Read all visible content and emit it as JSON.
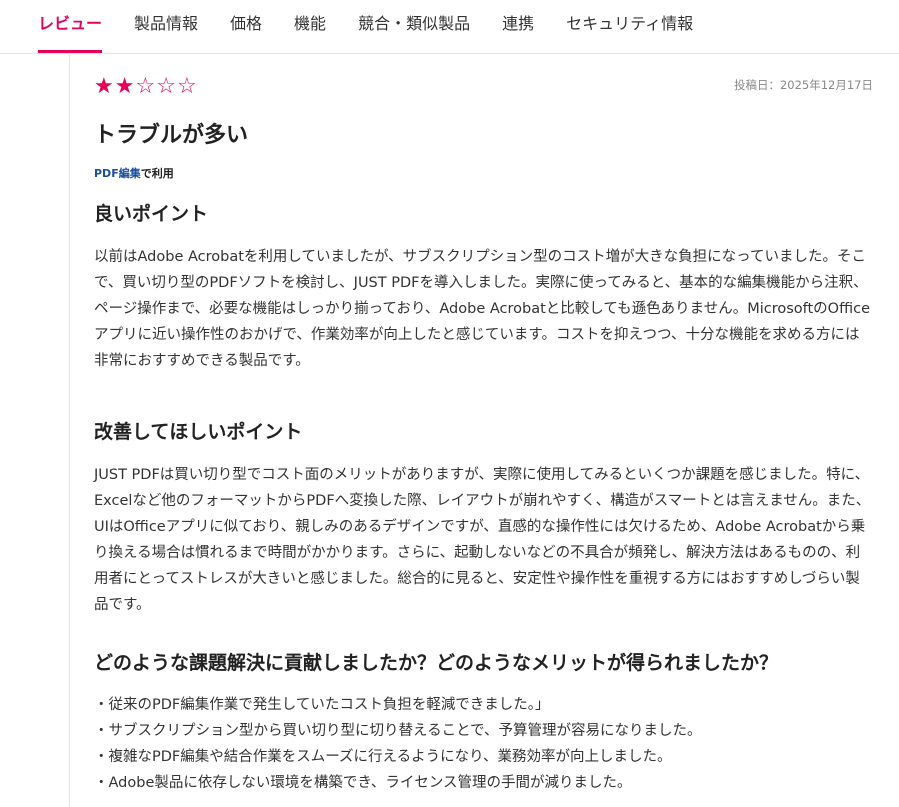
{
  "tabs": [
    {
      "label": "レビュー",
      "active": true
    },
    {
      "label": "製品情報",
      "active": false
    },
    {
      "label": "価格",
      "active": false
    },
    {
      "label": "機能",
      "active": false
    },
    {
      "label": "競合・類似製品",
      "active": false
    },
    {
      "label": "連携",
      "active": false
    },
    {
      "label": "セキュリティ情報",
      "active": false
    }
  ],
  "review": {
    "rating": 2,
    "rating_max": 5,
    "posted_date": "投稿日：2025年12月17日",
    "title": "トラブルが多い",
    "usage_category": "PDF編集",
    "usage_suffix": "で利用",
    "good_heading": "良いポイント",
    "good_text": "以前はAdobe Acrobatを利用していましたが、サブスクリプション型のコスト増が大きな負担になっていました。そこで、買い切り型のPDFソフトを検討し、JUST PDFを導入しました。実際に使ってみると、基本的な編集機能から注釈、ページ操作まで、必要な機能はしっかり揃っており、Adobe Acrobatと比較しても遜色ありません。MicrosoftのOfficeアプリに近い操作性のおかげで、作業効率が向上したと感じています。コストを抑えつつ、十分な機能を求める方には非常におすすめできる製品です。",
    "improve_heading": "改善してほしいポイント",
    "improve_text": "JUST PDFは買い切り型でコスト面のメリットがありますが、実際に使用してみるといくつか課題を感じました。特に、Excelなど他のフォーマットからPDFへ変換した際、レイアウトが崩れやすく、構造がスマートとは言えません。また、UIはOfficeアプリに似ており、親しみのあるデザインですが、直感的な操作性には欠けるため、Adobe Acrobatから乗り換える場合は慣れるまで時間がかかります。さらに、起動しないなどの不具合が頻発し、解決方法はあるものの、利用者にとってストレスが大きいと感じました。総合的に見ると、安定性や操作性を重視する方にはおすすめしづらい製品です。",
    "benefit_heading": "どのような課題解決に貢献しましたか？どのようなメリットが得られましたか？",
    "benefits": [
      "・従来のPDF編集作業で発生していたコスト負担を軽減できました。」",
      "・サブスクリプション型から買い切り型に切り替えることで、予算管理が容易になりました。",
      "・複雑なPDF編集や結合作業をスムーズに行えるようになり、業務効率が向上しました。",
      "・Adobe製品に依存しない環境を構築でき、ライセンス管理の手間が減りました。"
    ]
  }
}
